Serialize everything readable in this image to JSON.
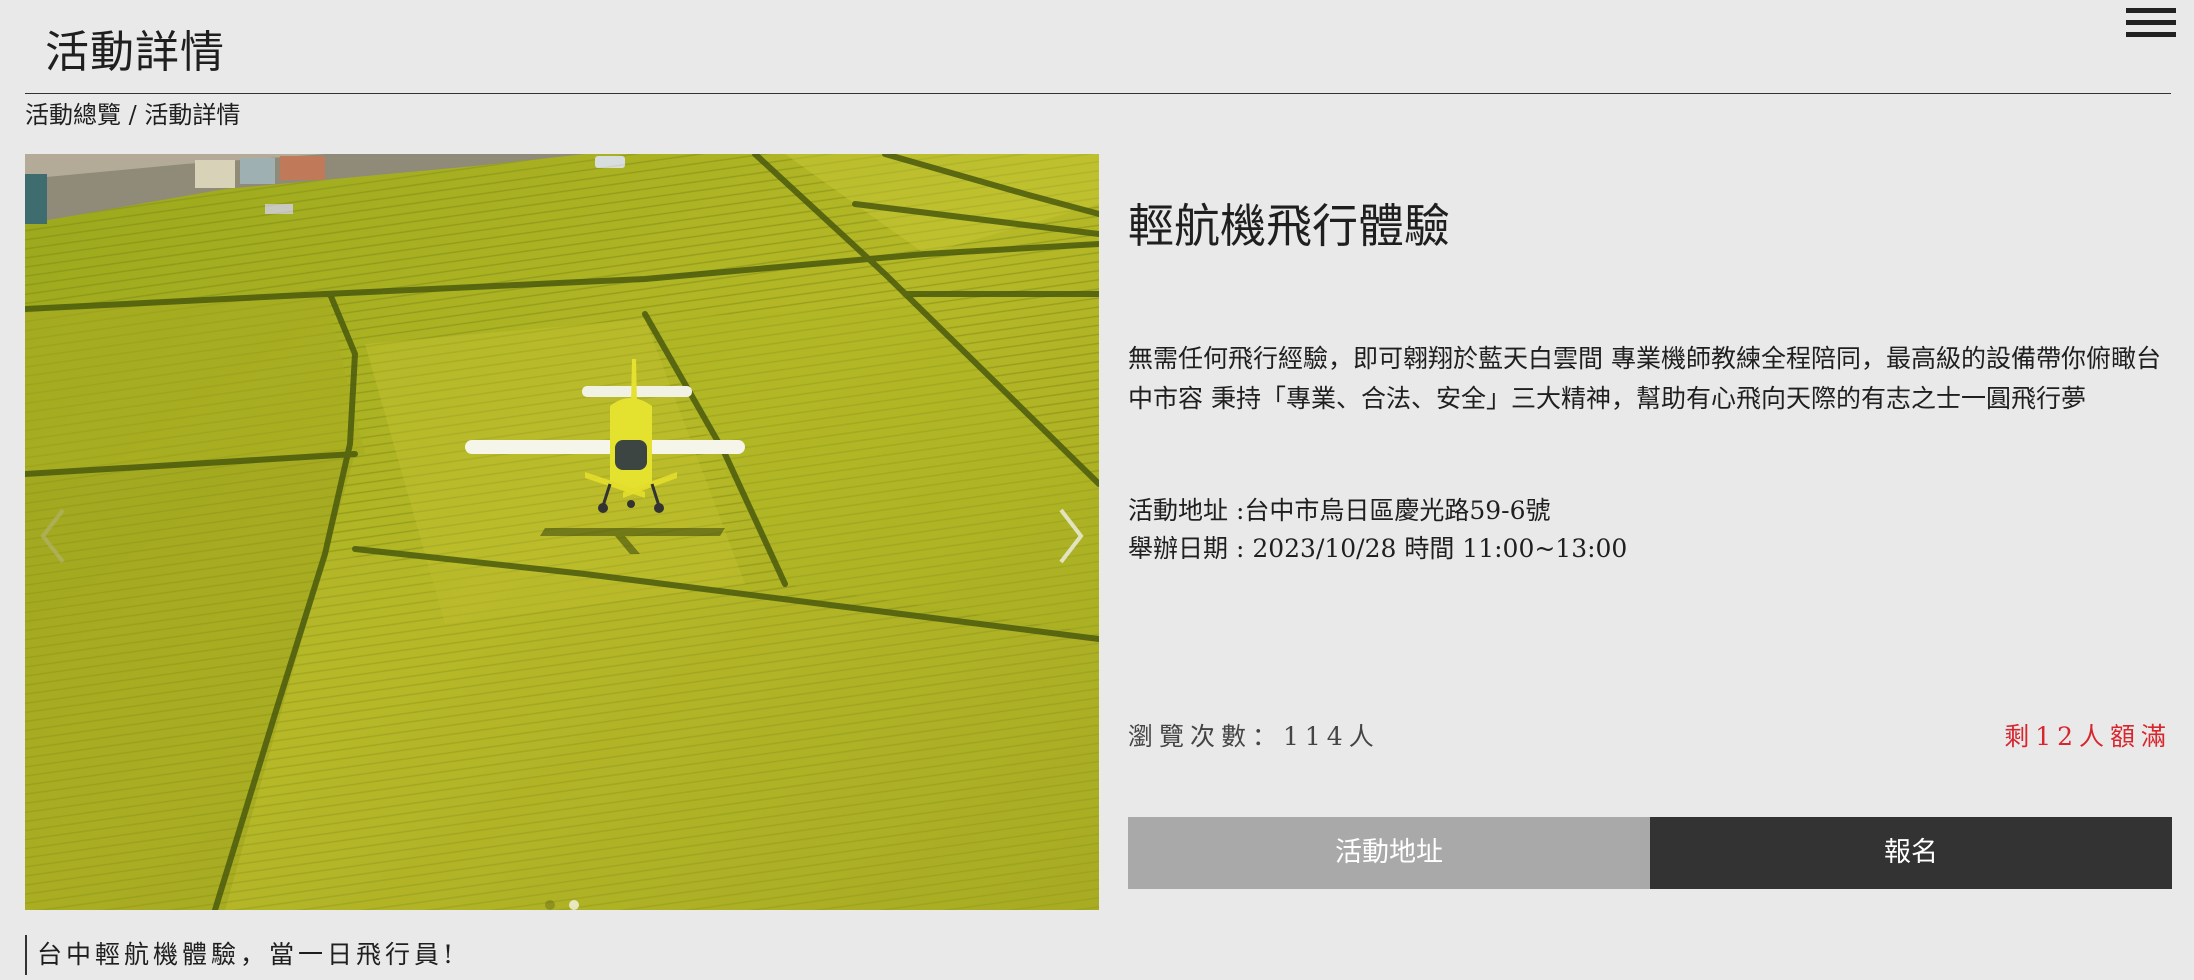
{
  "header": {
    "title": "活動詳情",
    "menu_icon": "hamburger-menu-icon"
  },
  "breadcrumb": {
    "parent": "活動總覽",
    "separator": " / ",
    "current": "活動詳情"
  },
  "carousel": {
    "image": "light aircraft flying over rice paddy fields",
    "slide_count": 2,
    "active_slide": 2
  },
  "event": {
    "title": "輕航機飛行體驗",
    "description": "無需任何飛行經驗，即可翱翔於藍天白雲間 專業機師教練全程陪同，最高級的設備帶你俯瞰台中市容 秉持「專業、合法、安全」三大精神，幫助有心飛向天際的有志之士一圓飛行夢",
    "address_line": "活動地址 :台中市烏日區慶光路59-6號",
    "date_line": "舉辦日期 : 2023/10/28 時間 11:00~13:00",
    "views": "瀏覽次數：114人",
    "remaining": "剩12人額滿"
  },
  "buttons": {
    "address": "活動地址",
    "signup": "報名"
  },
  "subtitle": "台中輕航機體驗，當一日飛行員!",
  "colors": {
    "background": "#e9e9e9",
    "accent_red": "#d7262d",
    "button_gray": "#a9a9a9",
    "button_dark": "#333333"
  }
}
